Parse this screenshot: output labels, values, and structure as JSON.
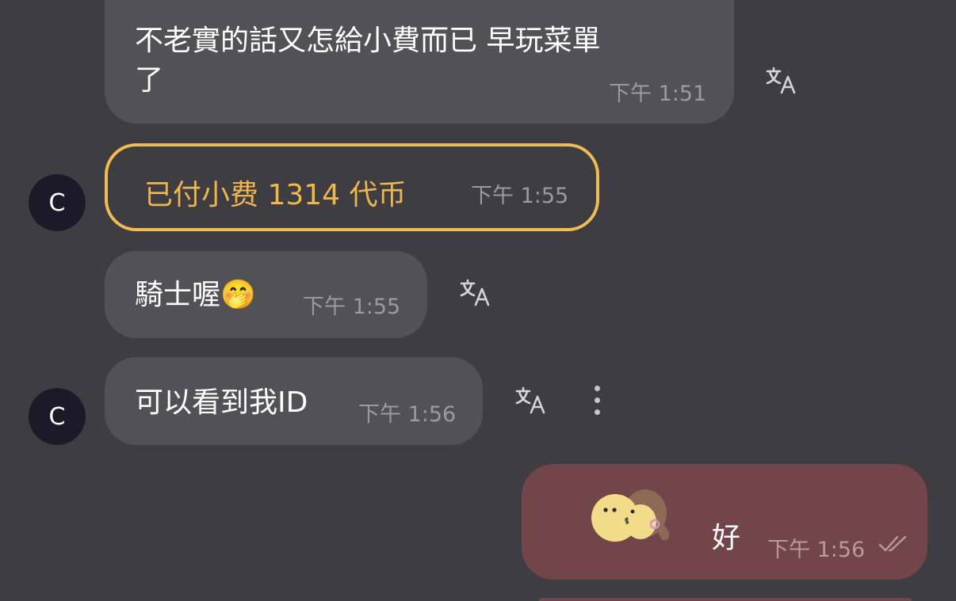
{
  "messages": [
    {
      "text_line1": "不老實的話又怎給小費而已 早玩菜單",
      "text_line2": "了",
      "time": "下午 1:51"
    },
    {
      "text": "騎士喔",
      "emoji": "🤭",
      "time": "下午 1:55"
    },
    {
      "text": "可以看到我ID",
      "time": "下午 1:56"
    }
  ],
  "tip": {
    "label": "已付小费 1314 代币",
    "time": "下午 1:55"
  },
  "avatar": {
    "initial": "C"
  },
  "outgoing": {
    "text": "好",
    "time": "下午 1:56",
    "status": "read"
  },
  "colors": {
    "background": "#3e3e42",
    "incoming_bubble": "#525256",
    "outgoing_bubble": "#714549",
    "tip_accent": "#f0bb52"
  }
}
